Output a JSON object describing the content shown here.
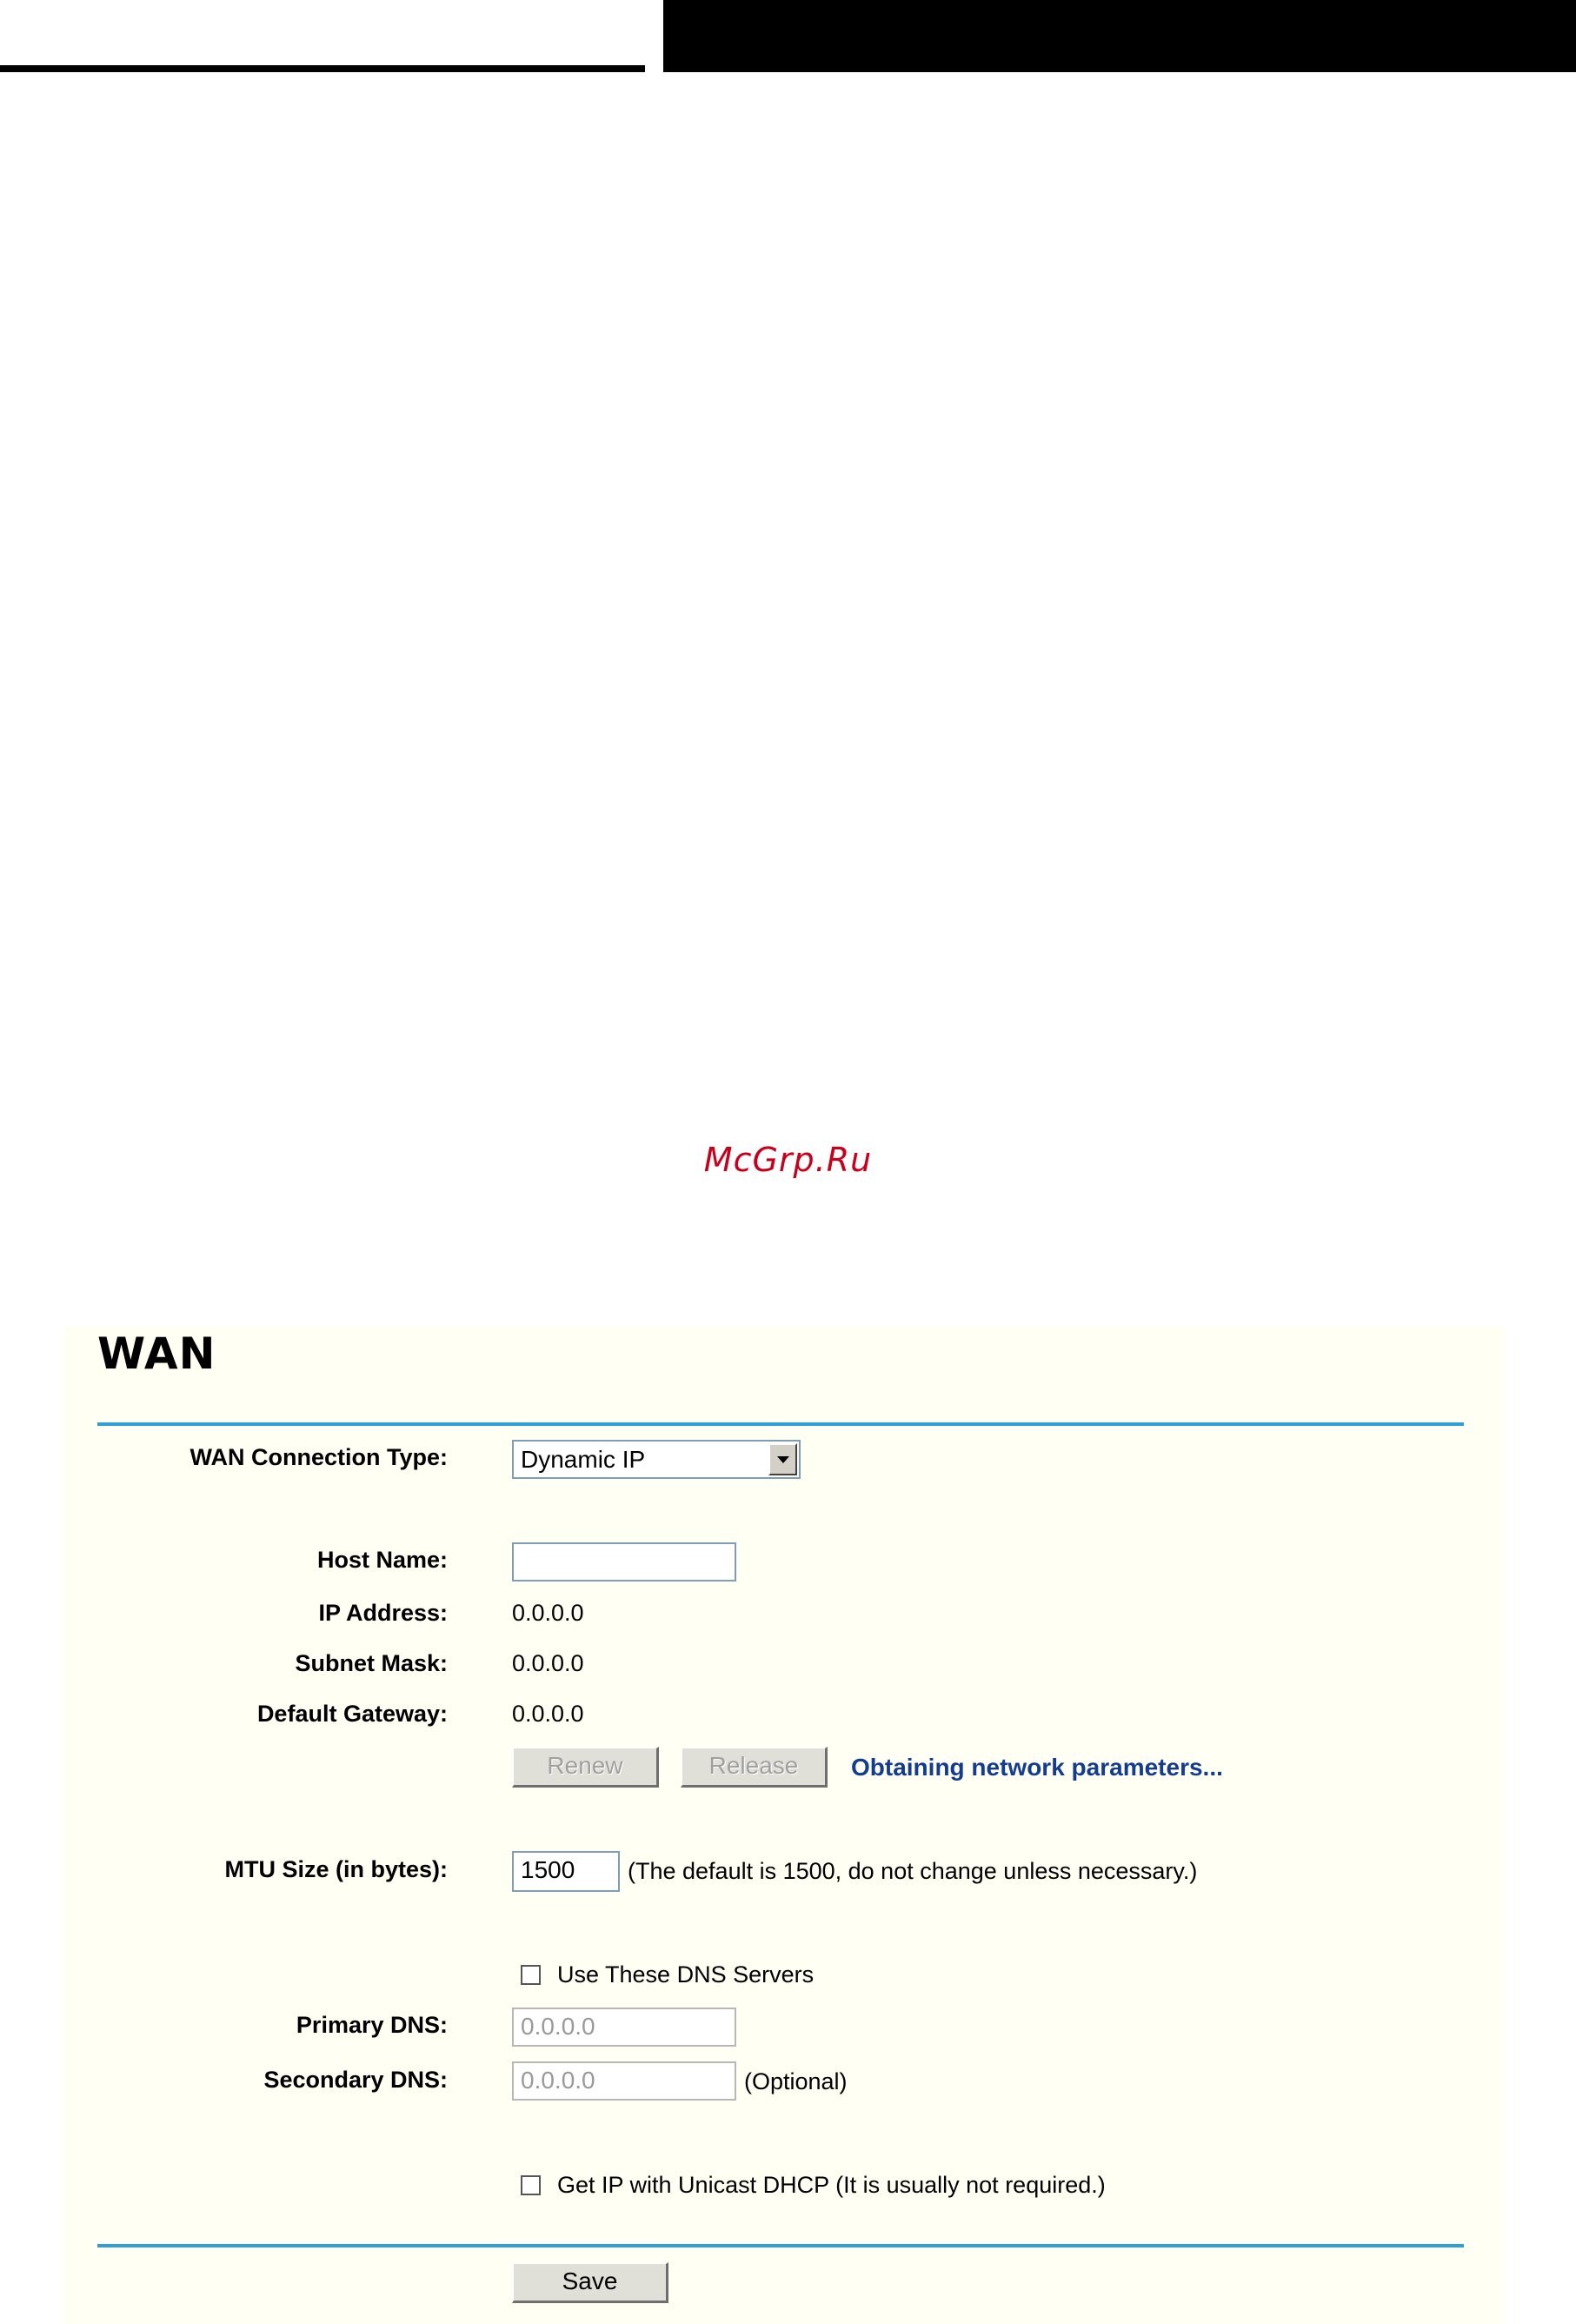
{
  "watermark": "McGrp.Ru",
  "page": {
    "title": "WAN"
  },
  "form": {
    "connection_type": {
      "label": "WAN Connection Type:",
      "selected": "Dynamic IP"
    },
    "host_name": {
      "label": "Host Name:",
      "value": ""
    },
    "ip_address": {
      "label": "IP Address:",
      "value": "0.0.0.0"
    },
    "subnet_mask": {
      "label": "Subnet Mask:",
      "value": "0.0.0.0"
    },
    "default_gateway": {
      "label": "Default Gateway:",
      "value": "0.0.0.0"
    },
    "buttons": {
      "renew": "Renew",
      "release": "Release",
      "save": "Save"
    },
    "status": "Obtaining network parameters...",
    "mtu": {
      "label": "MTU Size (in bytes):",
      "value": "1500",
      "hint": "(The default is 1500, do not change unless necessary.)"
    },
    "use_dns": {
      "label": "Use These DNS Servers",
      "checked": false
    },
    "primary_dns": {
      "label": "Primary DNS:",
      "placeholder": "0.0.0.0"
    },
    "secondary_dns": {
      "label": "Secondary DNS:",
      "placeholder": "0.0.0.0",
      "hint": "(Optional)"
    },
    "unicast_dhcp": {
      "label": "Get IP with Unicast DHCP (It is usually not required.)",
      "checked": false
    }
  },
  "colors": {
    "accent": "#2e9fd8",
    "status": "#133c8e",
    "panel_bg": "#fffff4",
    "watermark": "#c8001c"
  }
}
